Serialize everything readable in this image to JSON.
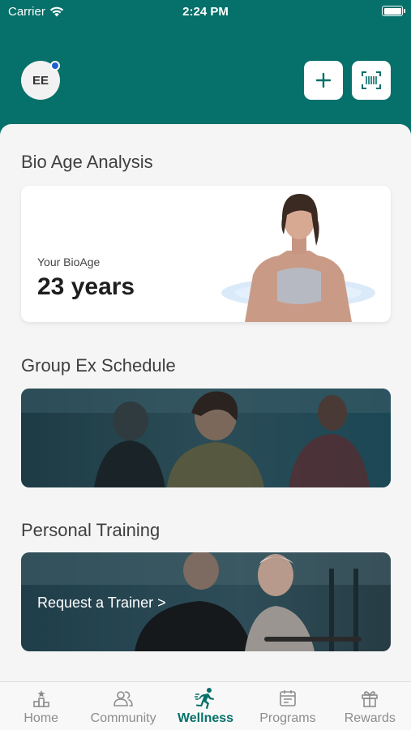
{
  "status_bar": {
    "carrier": "Carrier",
    "time": "2:24 PM"
  },
  "header": {
    "avatar_initials": "EE"
  },
  "bio_age": {
    "section_title": "Bio Age Analysis",
    "label": "Your BioAge",
    "value": "23 years"
  },
  "group_ex": {
    "section_title": "Group Ex Schedule"
  },
  "personal_training": {
    "section_title": "Personal Training",
    "link_label": "Request a Trainer >"
  },
  "tab_bar": {
    "items": [
      {
        "label": "Home",
        "icon": "home-icon"
      },
      {
        "label": "Community",
        "icon": "community-icon"
      },
      {
        "label": "Wellness",
        "icon": "wellness-icon",
        "active": true
      },
      {
        "label": "Programs",
        "icon": "programs-icon"
      },
      {
        "label": "Rewards",
        "icon": "rewards-icon"
      }
    ]
  },
  "colors": {
    "brand": "#06706a",
    "notification_dot": "#1f5fd1",
    "inactive_tab": "#8d8d8d"
  }
}
